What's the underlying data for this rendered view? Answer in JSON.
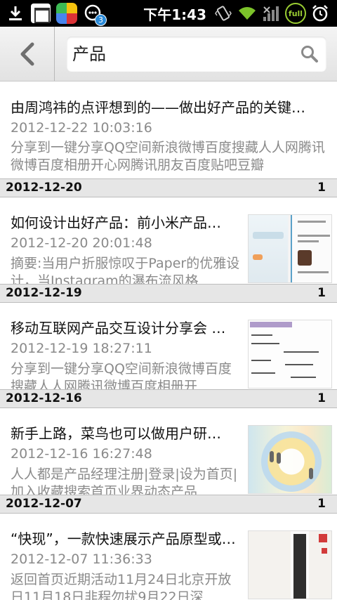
{
  "status_bar": {
    "time": "下午1:43",
    "notification_count": "3",
    "battery_label": "full",
    "icons": [
      "download-icon",
      "note-app-icon",
      "color-app-icon",
      "chat-icon",
      "vibrate-icon",
      "wifi-icon",
      "signal-icon",
      "battery-icon",
      "alarm-icon"
    ]
  },
  "header": {
    "back_icon": "chevron-left-icon",
    "search_query": "产品",
    "search_icon": "search-icon"
  },
  "first_item": {
    "title": "由周鸿祎的点评想到的——做出好产品的关键…",
    "time": "2012-12-22 10:03:16",
    "desc": "分享到一键分享QQ空间新浪微博百度搜藏人人网腾讯微博百度相册开心网腾讯朋友百度贴吧豆瓣"
  },
  "groups": [
    {
      "date": "2012-12-20",
      "count": "1",
      "title": "如何设计出好产品：前小米产品…",
      "time": "2012-12-20 20:01:48",
      "desc": "摘要:当用户折服惊叹于Paper的优雅设计，当Instagram的瀑布流风格"
    },
    {
      "date": "2012-12-19",
      "count": "1",
      "title": "移动互联网产品交互设计分享会 …",
      "time": "2012-12-19 18:27:11",
      "desc": "分享到一键分享QQ空间新浪微博百度搜藏人人网腾讯微博百度相册开"
    },
    {
      "date": "2012-12-16",
      "count": "1",
      "title": "新手上路，菜鸟也可以做用户研…",
      "time": "2012-12-16 16:27:48",
      "desc": "人人都是产品经理注册|登录|设为首页|加入收藏搜索首页业界动态产品"
    },
    {
      "date": "2012-12-07",
      "count": "1",
      "title": "“快现”，一款快速展示产品原型或…",
      "time": "2012-12-07 11:36:33",
      "desc": "返回首页近期活动11月24日北京开放日11月18日非程勿扰9月22日深"
    }
  ],
  "colors": {
    "status_bar_bg": "#000000",
    "header_bg": "#e8e8e8",
    "date_header_bg": "#e6e6e6",
    "secondary_text": "#8a8a8a",
    "battery_green": "#9acd32"
  }
}
